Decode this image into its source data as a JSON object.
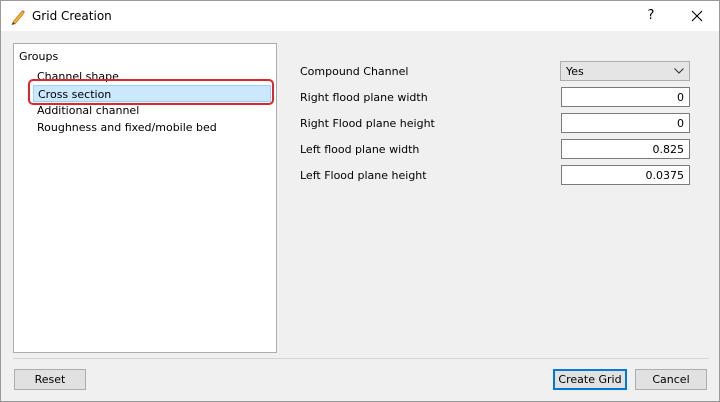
{
  "window": {
    "title": "Grid Creation",
    "help_glyph": "?",
    "title_icon": "pencil-icon",
    "close_icon": "close-icon"
  },
  "groups": {
    "title": "Groups",
    "items": [
      {
        "label": "Channel shape",
        "selected": false
      },
      {
        "label": "Cross section",
        "selected": true
      },
      {
        "label": "Additional channel",
        "selected": false
      },
      {
        "label": "Roughness and fixed/mobile bed",
        "selected": false
      }
    ]
  },
  "form": {
    "compound_channel": {
      "label": "Compound Channel",
      "value": "Yes"
    },
    "right_flood_plane_width": {
      "label": "Right flood plane width",
      "value": "0"
    },
    "right_flood_plane_height": {
      "label": "Right Flood plane height",
      "value": "0"
    },
    "left_flood_plane_width": {
      "label": "Left flood plane width",
      "value": "0.825"
    },
    "left_flood_plane_height": {
      "label": "Left Flood plane height",
      "value": "0.0375"
    }
  },
  "buttons": {
    "reset": "Reset",
    "create_grid": "Create Grid",
    "cancel": "Cancel"
  },
  "colors": {
    "selection_bg": "#cce8ff",
    "annotation_ring": "#e0262c",
    "default_button_border": "#0078d7"
  }
}
